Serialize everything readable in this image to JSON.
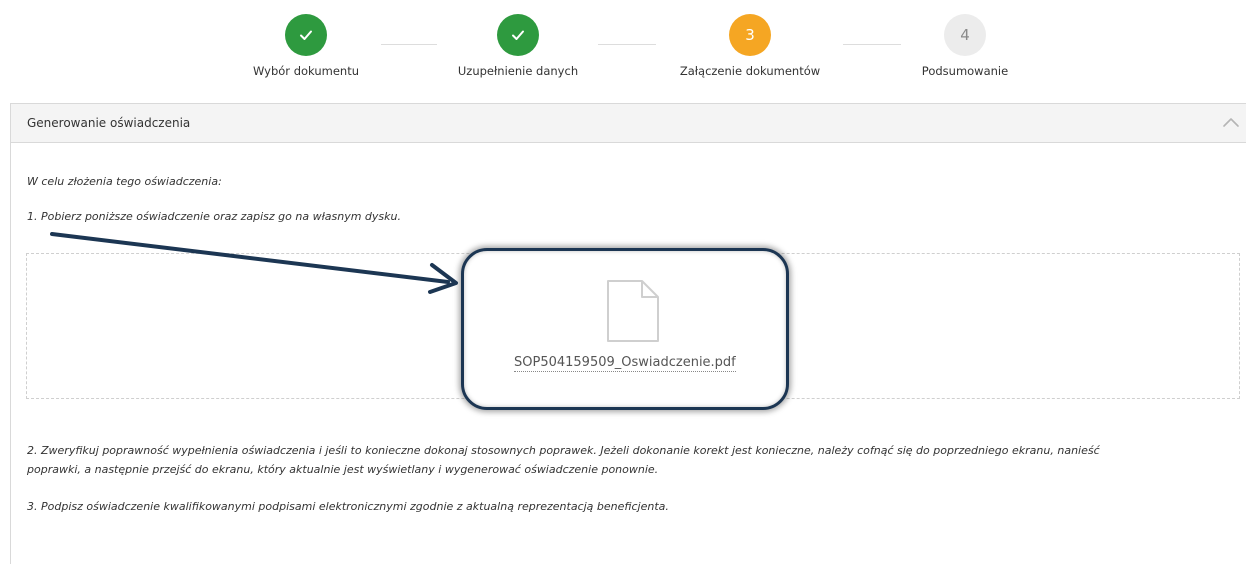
{
  "stepper": {
    "steps": [
      {
        "number": "✓",
        "label": "Wybór dokumentu",
        "state": "done"
      },
      {
        "number": "✓",
        "label": "Uzupełnienie danych",
        "state": "done"
      },
      {
        "number": "3",
        "label": "Załączenie dokumentów",
        "state": "active"
      },
      {
        "number": "4",
        "label": "Podsumowanie",
        "state": "todo"
      }
    ]
  },
  "panel": {
    "title": "Generowanie oświadczenia",
    "intro": "W celu złożenia tego oświadczenia:",
    "step1": "1. Pobierz poniższe oświadczenie oraz zapisz go na własnym dysku.",
    "file": {
      "name": "SOP504159509_Oswiadczenie.pdf",
      "icon": "file-icon"
    },
    "step2_line1": "2. Zweryfikuj poprawność wypełnienia oświadczenia i jeśli to konieczne dokonaj stosownych poprawek. Jeżeli dokonanie korekt jest konieczne, należy cofnąć się do poprzedniego ekranu, nanieść",
    "step2_line2": "poprawki, a następnie przejść do ekranu, który aktualnie jest wyświetlany i wygenerować oświadczenie ponownie.",
    "step3": "3. Podpisz oświadczenie kwalifikowanymi podpisami elektronicznymi zgodnie z aktualną reprezentacją beneficjenta."
  },
  "colors": {
    "done": "#2e9a3f",
    "active": "#f5a623",
    "todo": "#ececec",
    "annotation": "#1c3653"
  }
}
